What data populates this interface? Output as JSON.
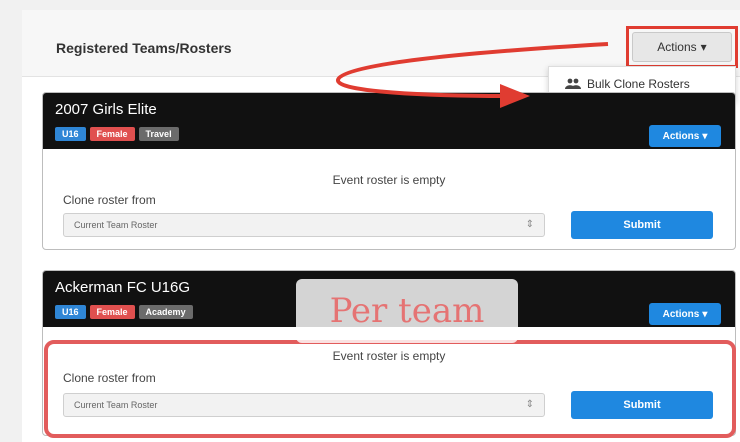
{
  "header": {
    "title": "Registered Teams/Rosters",
    "actions_label": "Actions",
    "actions_caret": "▾"
  },
  "dropdown": {
    "icon": "users-icon",
    "item_label": "Bulk Clone Rosters"
  },
  "teams": [
    {
      "name": "2007 Girls Elite",
      "tags": {
        "age": "U16",
        "gender": "Female",
        "type": "Travel"
      },
      "actions_label": "Actions",
      "empty_text": "Event roster is empty",
      "clone_label": "Clone roster from",
      "select_value": "Current Team Roster",
      "submit_label": "Submit"
    },
    {
      "name": "Ackerman FC U16G",
      "tags": {
        "age": "U16",
        "gender": "Female",
        "type": "Academy"
      },
      "actions_label": "Actions",
      "empty_text": "Event roster is empty",
      "clone_label": "Clone roster from",
      "select_value": "Current Team Roster",
      "submit_label": "Submit"
    }
  ],
  "annotation": {
    "label": "Per team",
    "color": "#e03c31"
  },
  "colors": {
    "primary_blue": "#1f88e0",
    "header_black": "#111111",
    "highlight_red": "#e03c31"
  }
}
